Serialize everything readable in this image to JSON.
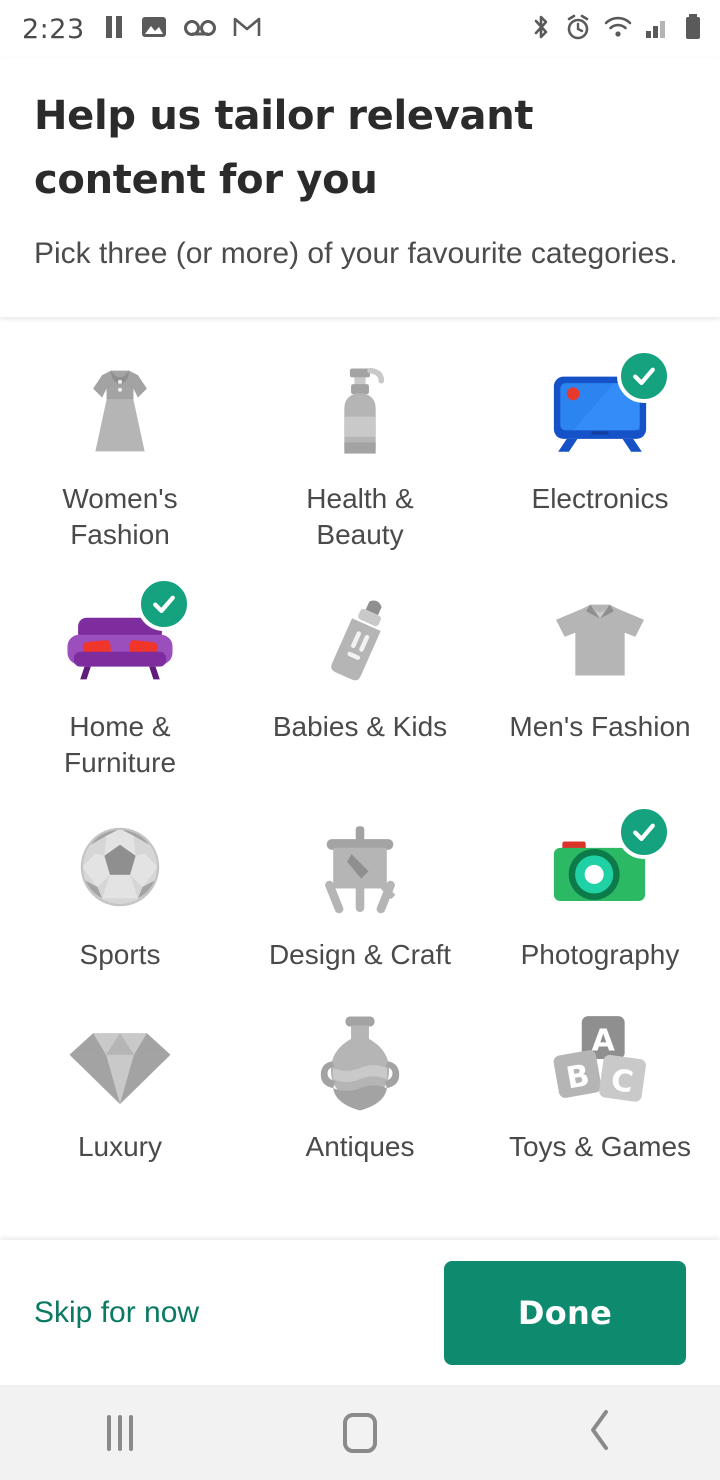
{
  "status_bar": {
    "time": "2:23",
    "left_icons": [
      "pause-icon",
      "image-icon",
      "voicemail-icon",
      "gmail-icon"
    ],
    "right_icons": [
      "bluetooth-icon",
      "alarm-icon",
      "wifi-icon",
      "signal-icon",
      "battery-icon"
    ]
  },
  "header": {
    "title": "Help us tailor relevant content for you",
    "subtitle": "Pick three (or more) of your favourite categories."
  },
  "colors": {
    "accent": "#0e8a6e",
    "badge": "#15a37f",
    "link": "#0b7a63",
    "title": "#2b2b2b",
    "label": "#4a4a4a",
    "icon_muted": "#b0b0b0"
  },
  "categories": [
    {
      "label": "Women's Fashion",
      "icon": "dress-icon",
      "selected": false
    },
    {
      "label": "Health & Beauty",
      "icon": "pump-bottle-icon",
      "selected": false
    },
    {
      "label": "Electronics",
      "icon": "television-icon",
      "selected": true
    },
    {
      "label": "Home & Furniture",
      "icon": "sofa-icon",
      "selected": true
    },
    {
      "label": "Babies & Kids",
      "icon": "baby-bottle-icon",
      "selected": false
    },
    {
      "label": "Men's Fashion",
      "icon": "polo-shirt-icon",
      "selected": false
    },
    {
      "label": "Sports",
      "icon": "soccer-ball-icon",
      "selected": false
    },
    {
      "label": "Design & Craft",
      "icon": "easel-icon",
      "selected": false
    },
    {
      "label": "Photography",
      "icon": "camera-icon",
      "selected": true
    },
    {
      "label": "Luxury",
      "icon": "diamond-icon",
      "selected": false
    },
    {
      "label": "Antiques",
      "icon": "vase-icon",
      "selected": false
    },
    {
      "label": "Toys & Games",
      "icon": "abc-blocks-icon",
      "selected": false
    }
  ],
  "footer": {
    "skip_label": "Skip for now",
    "done_label": "Done"
  },
  "nav_bar": {
    "recents_label": "recents-icon",
    "home_label": "home-icon",
    "back_label": "back-icon"
  }
}
